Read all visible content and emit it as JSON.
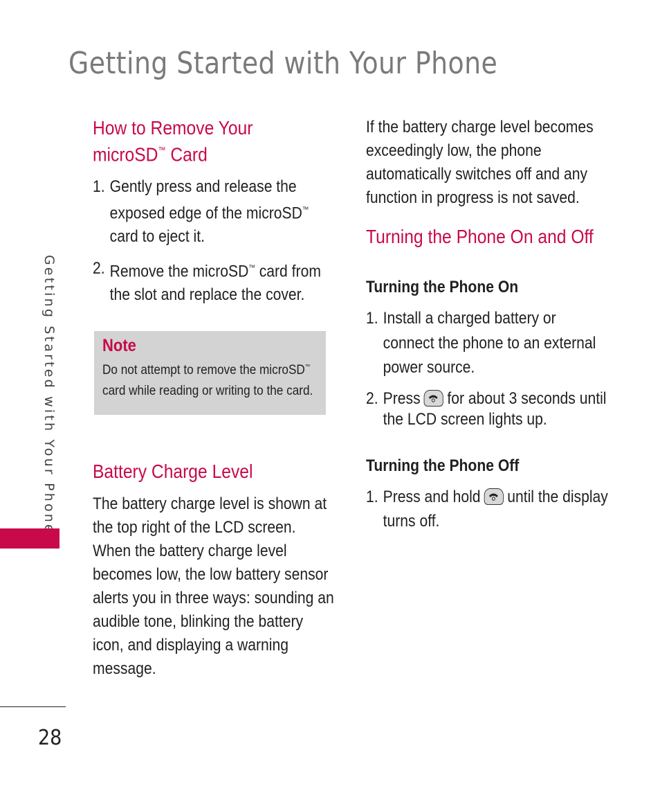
{
  "page": {
    "title": "Getting Started with Your Phone",
    "side_tab": "Getting Started with Your Phone",
    "page_number": "28",
    "accent_color": "#c8094a"
  },
  "left_column": {
    "remove_card": {
      "heading_line1": "How to Remove Your",
      "heading_line2_pre": "microSD",
      "heading_tm": "™",
      "heading_line2_post": " Card",
      "steps": [
        {
          "num": "1.",
          "pre": "Gently press and release the exposed edge of the microSD",
          "tm": "™",
          "post": " card to eject it."
        },
        {
          "num": "2.",
          "pre": "Remove the microSD",
          "tm": "™",
          "post": " card from the slot and replace the cover."
        }
      ]
    },
    "note": {
      "label": "Note",
      "text_pre": "Do not attempt to remove the microSD",
      "tm": "™",
      "text_post": " card while reading or writing to the card."
    },
    "battery": {
      "heading": "Battery Charge Level",
      "body": "The battery charge level is shown at the top right of the LCD screen. When the battery charge level becomes low, the low battery sensor alerts you in three ways: sounding an audible tone, blinking the battery icon, and displaying a warning message."
    }
  },
  "right_column": {
    "battery_continued": "If the battery charge level becomes exceedingly low, the phone automatically switches off and any function in progress is not saved.",
    "power": {
      "heading": "Turning the Phone On and Off",
      "on": {
        "heading": "Turning the Phone On",
        "steps": [
          {
            "num": "1.",
            "text": "Install a charged battery or connect the phone to an external power source."
          },
          {
            "num": "2.",
            "pre": "Press",
            "icon": "end-power-key-icon",
            "post": "for about 3 seconds until the LCD screen lights up."
          }
        ]
      },
      "off": {
        "heading": "Turning the Phone Off",
        "steps": [
          {
            "num": "1.",
            "pre": "Press and hold",
            "icon": "end-power-key-icon",
            "post": "until the display turns off."
          }
        ]
      }
    }
  }
}
